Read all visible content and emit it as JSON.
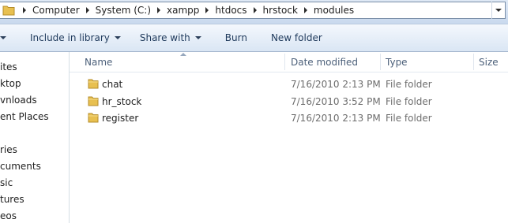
{
  "address_bar": {
    "crumbs": [
      "Computer",
      "System (C:)",
      "xampp",
      "htdocs",
      "hrstock",
      "modules"
    ]
  },
  "toolbar": {
    "include_in_library": "Include in library",
    "share_with": "Share with",
    "burn": "Burn",
    "new_folder": "New folder"
  },
  "nav_pane": {
    "items": [
      "ites",
      "ktop",
      "vnloads",
      "ent Places",
      "ries",
      "cuments",
      "sic",
      "tures",
      "eos"
    ]
  },
  "columns": {
    "name": "Name",
    "date_modified": "Date modified",
    "type": "Type",
    "size": "Size"
  },
  "files": [
    {
      "name": "chat",
      "date_modified": "7/16/2010 2:13 PM",
      "type": "File folder"
    },
    {
      "name": "hr_stock",
      "date_modified": "7/16/2010 3:52 PM",
      "type": "File folder"
    },
    {
      "name": "register",
      "date_modified": "7/16/2010 2:13 PM",
      "type": "File folder"
    }
  ],
  "colors": {
    "folder_yellow": "#e8c050",
    "toolbar_text": "#1e395b",
    "header_text": "#4c607a"
  }
}
